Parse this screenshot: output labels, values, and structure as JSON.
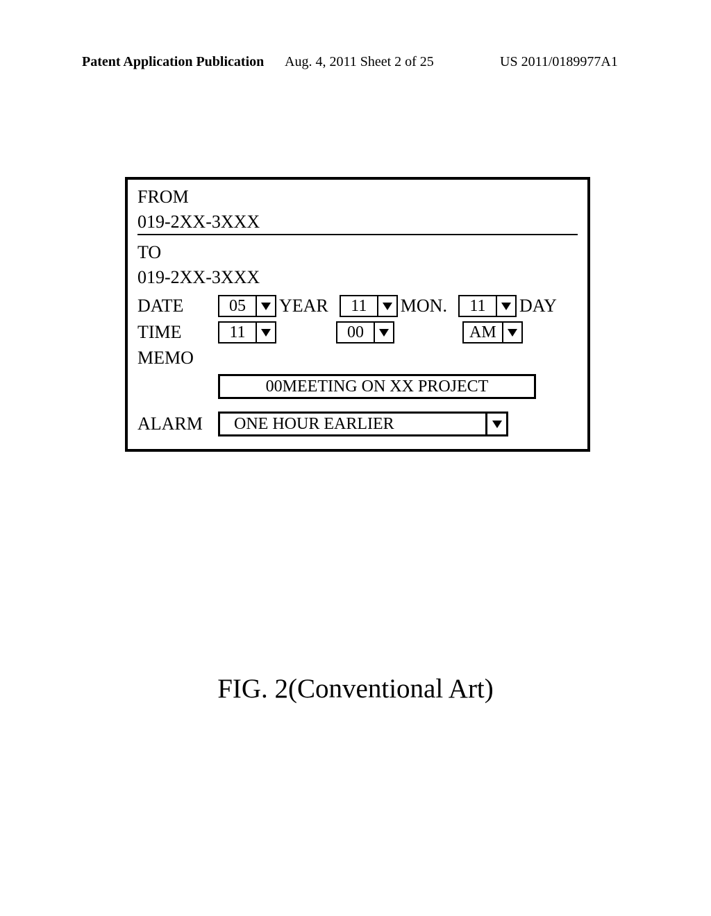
{
  "header": {
    "left": "Patent Application Publication",
    "center": "Aug. 4, 2011  Sheet 2 of 25",
    "right": "US 2011/0189977A1"
  },
  "form": {
    "from_label": "FROM",
    "from_value": "019-2XX-3XXX",
    "to_label": "TO",
    "to_value": "019-2XX-3XXX",
    "date_label": "DATE",
    "date": {
      "year_val": "05",
      "year_unit": "YEAR",
      "mon_val": "11",
      "mon_unit": "MON.",
      "day_val": "11",
      "day_unit": "DAY"
    },
    "time_label": "TIME",
    "time": {
      "hour_val": "11",
      "min_val": "00",
      "ampm_val": "AM"
    },
    "memo_label": "MEMO",
    "memo_value": "00MEETING ON XX PROJECT",
    "alarm_label": "ALARM",
    "alarm_value": "ONE HOUR EARLIER"
  },
  "caption": "FIG. 2(Conventional Art)"
}
